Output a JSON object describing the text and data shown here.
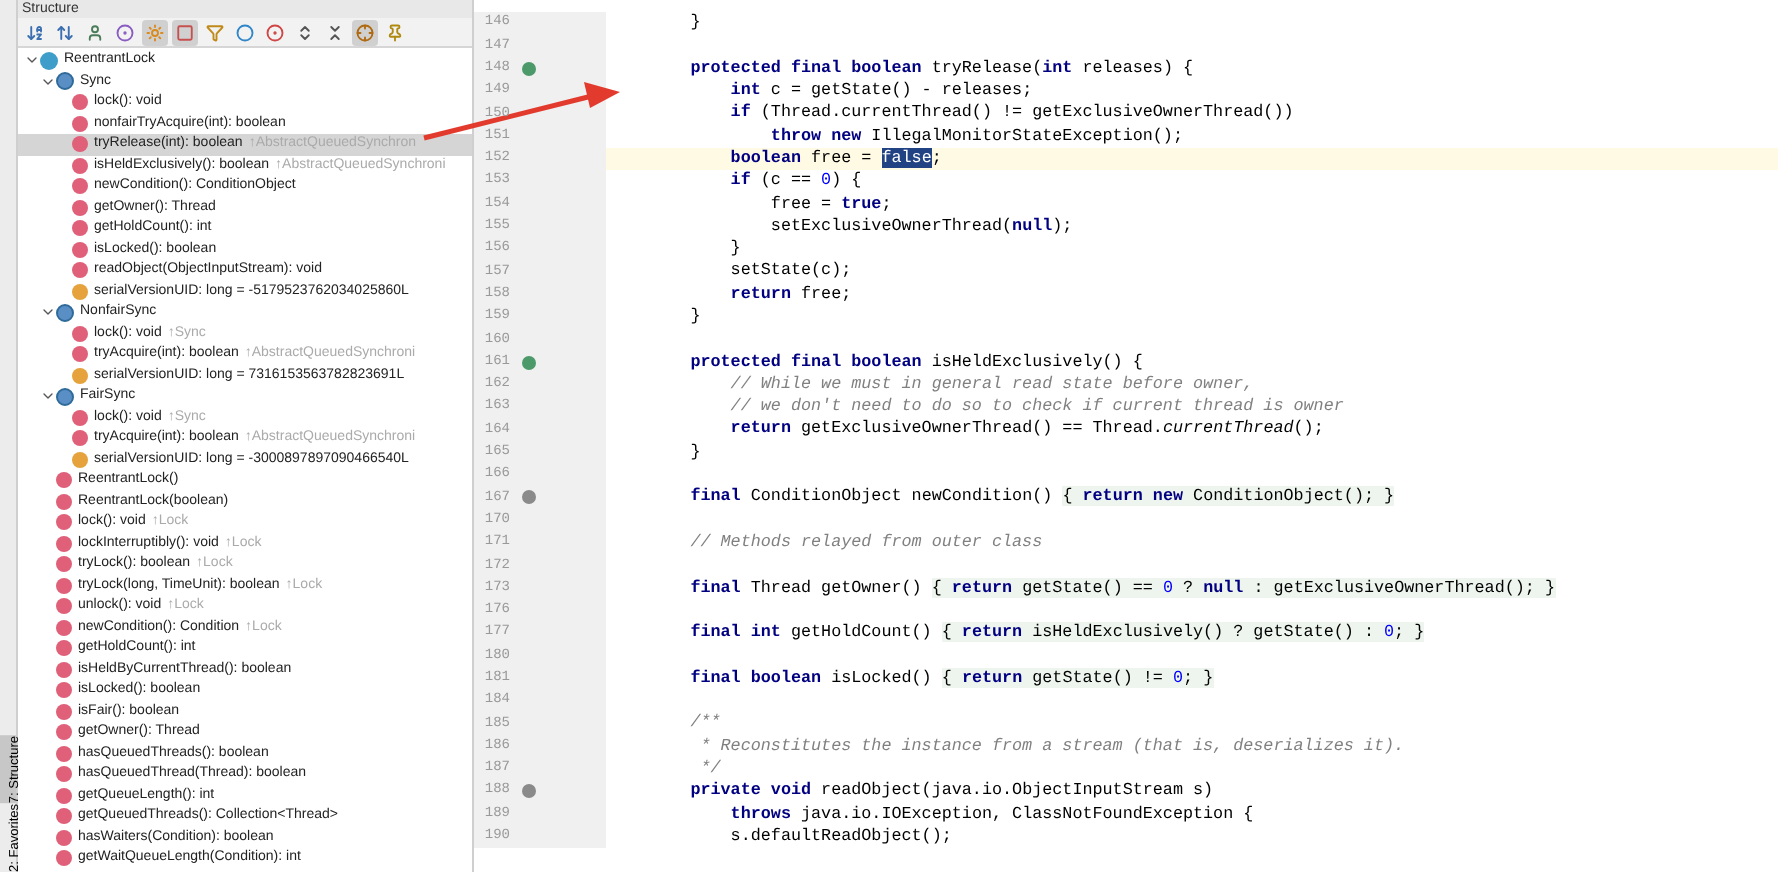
{
  "panel": {
    "title": "Structure"
  },
  "toolbar": [
    {
      "kind": "sort-alpha",
      "selected": false
    },
    {
      "kind": "sort-type",
      "selected": false
    },
    {
      "kind": "figure",
      "selected": false
    },
    {
      "kind": "dot",
      "selected": false
    },
    {
      "kind": "sun",
      "selected": true
    },
    {
      "kind": "square",
      "selected": true
    },
    {
      "kind": "filter",
      "selected": false
    },
    {
      "kind": "ring",
      "selected": false
    },
    {
      "kind": "record",
      "selected": false
    },
    {
      "kind": "expand",
      "selected": false
    },
    {
      "kind": "collapse",
      "selected": false
    },
    {
      "kind": "autoscroll",
      "selected": true
    },
    {
      "kind": "pin",
      "selected": false
    }
  ],
  "tree": [
    {
      "kind": "class",
      "label": "ReentrantLock",
      "expanded": true,
      "selected": false,
      "children": [
        {
          "kind": "innerclass",
          "label": "Sync",
          "expanded": true,
          "selected": false,
          "children": [
            {
              "kind": "method",
              "label": "lock(): void",
              "selected": false
            },
            {
              "kind": "method",
              "label": "nonfairTryAcquire(int): boolean",
              "selected": false
            },
            {
              "kind": "method",
              "label": "tryRelease(int): boolean",
              "suffix": "↑AbstractQueuedSynchron",
              "selected": true
            },
            {
              "kind": "method",
              "label": "isHeldExclusively(): boolean",
              "suffix": "↑AbstractQueuedSynchroni",
              "selected": false
            },
            {
              "kind": "method",
              "label": "newCondition(): ConditionObject",
              "selected": false
            },
            {
              "kind": "method",
              "label": "getOwner(): Thread",
              "selected": false
            },
            {
              "kind": "method",
              "label": "getHoldCount(): int",
              "selected": false
            },
            {
              "kind": "method",
              "label": "isLocked(): boolean",
              "selected": false
            },
            {
              "kind": "method",
              "label": "readObject(ObjectInputStream): void",
              "selected": false
            },
            {
              "kind": "field",
              "label": "serialVersionUID: long = -5179523762034025860L",
              "selected": false
            }
          ]
        },
        {
          "kind": "innerclass",
          "label": "NonfairSync",
          "expanded": true,
          "selected": false,
          "children": [
            {
              "kind": "method",
              "label": "lock(): void",
              "suffix": "↑Sync",
              "selected": false
            },
            {
              "kind": "method",
              "label": "tryAcquire(int): boolean",
              "suffix": "↑AbstractQueuedSynchroni",
              "selected": false
            },
            {
              "kind": "field",
              "label": "serialVersionUID: long = 7316153563782823691L",
              "selected": false
            }
          ]
        },
        {
          "kind": "innerclass",
          "label": "FairSync",
          "expanded": true,
          "selected": false,
          "children": [
            {
              "kind": "method",
              "label": "lock(): void",
              "suffix": "↑Sync",
              "selected": false
            },
            {
              "kind": "method",
              "label": "tryAcquire(int): boolean",
              "suffix": "↑AbstractQueuedSynchroni",
              "selected": false
            },
            {
              "kind": "field",
              "label": "serialVersionUID: long = -3000897897090466540L",
              "selected": false
            }
          ]
        },
        {
          "kind": "method",
          "label": "ReentrantLock()",
          "selected": false
        },
        {
          "kind": "method",
          "label": "ReentrantLock(boolean)",
          "selected": false
        },
        {
          "kind": "method",
          "label": "lock(): void",
          "suffix": "↑Lock",
          "selected": false
        },
        {
          "kind": "method",
          "label": "lockInterruptibly(): void",
          "suffix": "↑Lock",
          "selected": false
        },
        {
          "kind": "method",
          "label": "tryLock(): boolean",
          "suffix": "↑Lock",
          "selected": false
        },
        {
          "kind": "method",
          "label": "tryLock(long, TimeUnit): boolean",
          "suffix": "↑Lock",
          "selected": false
        },
        {
          "kind": "method",
          "label": "unlock(): void",
          "suffix": "↑Lock",
          "selected": false
        },
        {
          "kind": "method",
          "label": "newCondition(): Condition",
          "suffix": "↑Lock",
          "selected": false
        },
        {
          "kind": "method",
          "label": "getHoldCount(): int",
          "selected": false
        },
        {
          "kind": "method",
          "label": "isHeldByCurrentThread(): boolean",
          "selected": false
        },
        {
          "kind": "method",
          "label": "isLocked(): boolean",
          "selected": false
        },
        {
          "kind": "method",
          "label": "isFair(): boolean",
          "selected": false
        },
        {
          "kind": "method",
          "label": "getOwner(): Thread",
          "selected": false
        },
        {
          "kind": "method",
          "label": "hasQueuedThreads(): boolean",
          "selected": false
        },
        {
          "kind": "method",
          "label": "hasQueuedThread(Thread): boolean",
          "selected": false
        },
        {
          "kind": "method",
          "label": "getQueueLength(): int",
          "selected": false
        },
        {
          "kind": "method",
          "label": "getQueuedThreads(): Collection<Thread>",
          "selected": false
        },
        {
          "kind": "method",
          "label": "hasWaiters(Condition): boolean",
          "selected": false
        },
        {
          "kind": "method",
          "label": "getWaitQueueLength(Condition): int",
          "selected": false
        }
      ]
    }
  ],
  "side_tabs": [
    {
      "label": "7: Structure",
      "selected": true
    },
    {
      "label": "2: Favorites",
      "selected": false
    }
  ],
  "editor": {
    "lines": [
      {
        "number": "146",
        "code": [
          {
            "t": "        }"
          }
        ]
      },
      {
        "number": "147"
      },
      {
        "number": "148",
        "gutter": {
          "kind": "override"
        },
        "code": [
          {
            "kind": "kw",
            "t": "        protected final boolean "
          },
          {
            "t": "tryRelease("
          },
          {
            "kind": "kw",
            "t": "int "
          },
          {
            "t": "releases) {"
          }
        ]
      },
      {
        "number": "149",
        "code": [
          {
            "kind": "kw",
            "t": "            int "
          },
          {
            "t": "c = getState() - releases;"
          }
        ]
      },
      {
        "number": "150",
        "code": [
          {
            "kind": "kw",
            "t": "            if "
          },
          {
            "t": "(Thread.currentThread() != getExclusiveOwnerThread())"
          }
        ]
      },
      {
        "number": "151",
        "code": [
          {
            "kind": "kw",
            "t": "                throw new "
          },
          {
            "t": "IllegalMonitorStateException();"
          }
        ]
      },
      {
        "number": "152",
        "current": true,
        "code": [
          {
            "kind": "kw",
            "t": "            boolean "
          },
          {
            "t": "free = "
          },
          {
            "kind": "selection",
            "t": "false"
          },
          {
            "t": ";"
          }
        ]
      },
      {
        "number": "153",
        "code": [
          {
            "kind": "kw",
            "t": "            if "
          },
          {
            "t": "(c == "
          },
          {
            "kind": "num",
            "t": "0"
          },
          {
            "t": ") {"
          }
        ]
      },
      {
        "number": "154",
        "code": [
          {
            "t": "                free = "
          },
          {
            "kind": "kw",
            "t": "true"
          },
          {
            "t": ";"
          }
        ]
      },
      {
        "number": "155",
        "code": [
          {
            "t": "                setExclusiveOwnerThread("
          },
          {
            "kind": "kw",
            "t": "null"
          },
          {
            "t": ");"
          }
        ]
      },
      {
        "number": "156",
        "code": [
          {
            "t": "            }"
          }
        ]
      },
      {
        "number": "157",
        "code": [
          {
            "t": "            setState(c);"
          }
        ]
      },
      {
        "number": "158",
        "code": [
          {
            "kind": "kw",
            "t": "            return "
          },
          {
            "t": "free;"
          }
        ]
      },
      {
        "number": "159",
        "code": [
          {
            "t": "        }"
          }
        ]
      },
      {
        "number": "160"
      },
      {
        "number": "161",
        "gutter": {
          "kind": "override"
        },
        "code": [
          {
            "kind": "kw",
            "t": "        protected final boolean "
          },
          {
            "t": "isHeldExclusively() {"
          }
        ]
      },
      {
        "number": "162",
        "code": [
          {
            "kind": "comment",
            "t": "            // While we must in general read state before owner,"
          }
        ]
      },
      {
        "number": "163",
        "code": [
          {
            "kind": "comment",
            "t": "            // we don't need to do so to check if current thread is owner"
          }
        ]
      },
      {
        "number": "164",
        "code": [
          {
            "kind": "kw",
            "t": "            return "
          },
          {
            "t": "getExclusiveOwnerThread() == Thread."
          },
          {
            "kind": "italic",
            "t": "currentThread"
          },
          {
            "t": "();"
          }
        ]
      },
      {
        "number": "165",
        "code": [
          {
            "t": "        }"
          }
        ]
      },
      {
        "number": "166"
      },
      {
        "number": "167",
        "gutter": {
          "kind": "dot"
        },
        "code": [
          {
            "kind": "kw",
            "t": "        final "
          },
          {
            "t": "ConditionObject newCondition() "
          },
          {
            "kind": "fold",
            "t": "{ "
          },
          {
            "kind": "fold-kw",
            "t": "return new "
          },
          {
            "kind": "fold",
            "t": "ConditionObject(); }"
          }
        ]
      },
      {
        "number": "170"
      },
      {
        "number": "171",
        "code": [
          {
            "kind": "comment",
            "t": "        // Methods relayed from outer class"
          }
        ]
      },
      {
        "number": "172"
      },
      {
        "number": "173",
        "code": [
          {
            "kind": "kw",
            "t": "        final "
          },
          {
            "t": "Thread getOwner() "
          },
          {
            "kind": "fold",
            "t": "{ "
          },
          {
            "kind": "fold-kw",
            "t": "return "
          },
          {
            "kind": "fold",
            "t": "getState() == "
          },
          {
            "kind": "fold-num",
            "t": "0"
          },
          {
            "kind": "fold",
            "t": " ? "
          },
          {
            "kind": "fold-kw",
            "t": "null"
          },
          {
            "kind": "fold",
            "t": " : getExclusiveOwnerThread(); }"
          }
        ]
      },
      {
        "number": "176"
      },
      {
        "number": "177",
        "code": [
          {
            "kind": "kw",
            "t": "        final int "
          },
          {
            "t": "getHoldCount() "
          },
          {
            "kind": "fold",
            "t": "{ "
          },
          {
            "kind": "fold-kw",
            "t": "return "
          },
          {
            "kind": "fold",
            "t": "isHeldExclusively() ? getState() : "
          },
          {
            "kind": "fold-num",
            "t": "0"
          },
          {
            "kind": "fold",
            "t": "; }"
          }
        ]
      },
      {
        "number": "180"
      },
      {
        "number": "181",
        "code": [
          {
            "kind": "kw",
            "t": "        final boolean "
          },
          {
            "t": "isLocked() "
          },
          {
            "kind": "fold",
            "t": "{ "
          },
          {
            "kind": "fold-kw",
            "t": "return "
          },
          {
            "kind": "fold",
            "t": "getState() != "
          },
          {
            "kind": "fold-num",
            "t": "0"
          },
          {
            "kind": "fold",
            "t": "; }"
          }
        ]
      },
      {
        "number": "184"
      },
      {
        "number": "185",
        "code": [
          {
            "kind": "comment",
            "t": "        /**"
          }
        ]
      },
      {
        "number": "186",
        "code": [
          {
            "kind": "comment",
            "t": "         * Reconstitutes the instance from a stream (that is, deserializes it)."
          }
        ]
      },
      {
        "number": "187",
        "code": [
          {
            "kind": "comment",
            "t": "         */"
          }
        ]
      },
      {
        "number": "188",
        "gutter": {
          "kind": "dot"
        },
        "code": [
          {
            "kind": "kw",
            "t": "        private void "
          },
          {
            "t": "readObject(java.io.ObjectInputStream s)"
          }
        ]
      },
      {
        "number": "189",
        "code": [
          {
            "kind": "kw",
            "t": "            throws "
          },
          {
            "t": "java.io.IOException, ClassNotFoundException {"
          }
        ]
      },
      {
        "number": "190",
        "code": [
          {
            "t": "            s.defaultReadObject();"
          }
        ]
      }
    ]
  }
}
